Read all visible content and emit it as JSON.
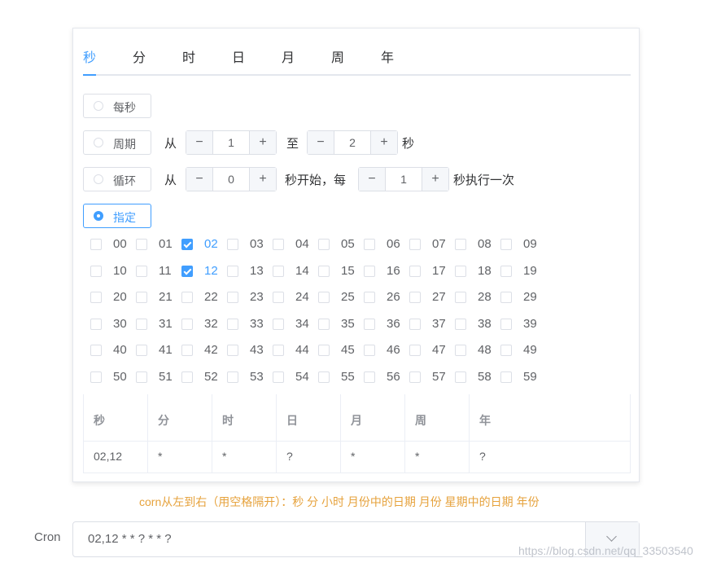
{
  "tabs": [
    "秒",
    "分",
    "时",
    "日",
    "月",
    "周",
    "年"
  ],
  "radios": {
    "every": "每秒",
    "period": "周期",
    "loop": "循环",
    "specify": "指定"
  },
  "period": {
    "from_text": "从",
    "from_value": "1",
    "to_text": "至",
    "to_value": "2",
    "unit": "秒"
  },
  "loop": {
    "from_text": "从",
    "start_value": "0",
    "middle_text": "秒开始，每",
    "step_value": "1",
    "end_text": "秒执行一次"
  },
  "stepper": {
    "minus": "−",
    "plus": "+"
  },
  "checked_seconds": [
    "02",
    "12"
  ],
  "seconds": [
    "00",
    "01",
    "02",
    "03",
    "04",
    "05",
    "06",
    "07",
    "08",
    "09",
    "10",
    "11",
    "12",
    "13",
    "14",
    "15",
    "16",
    "17",
    "18",
    "19",
    "20",
    "21",
    "22",
    "23",
    "24",
    "25",
    "26",
    "27",
    "28",
    "29",
    "30",
    "31",
    "32",
    "33",
    "34",
    "35",
    "36",
    "37",
    "38",
    "39",
    "40",
    "41",
    "42",
    "43",
    "44",
    "45",
    "46",
    "47",
    "48",
    "49",
    "50",
    "51",
    "52",
    "53",
    "54",
    "55",
    "56",
    "57",
    "58",
    "59"
  ],
  "table": {
    "headers": [
      "秒",
      "分",
      "时",
      "日",
      "月",
      "周",
      "年"
    ],
    "values": [
      "02,12",
      "*",
      "*",
      "?",
      "*",
      "*",
      "?"
    ]
  },
  "hint": "corn从左到右（用空格隔开）：秒 分 小时 月份中的日期 月份 星期中的日期 年份",
  "cron": {
    "label": "Cron",
    "value": "02,12 * * ? * * ?"
  },
  "watermark": "https://blog.csdn.net/qq_33503540",
  "colors": {
    "accent": "#409eff",
    "hint": "#e6a23c"
  },
  "icons": {
    "dropdown": "chevron-down-icon"
  }
}
